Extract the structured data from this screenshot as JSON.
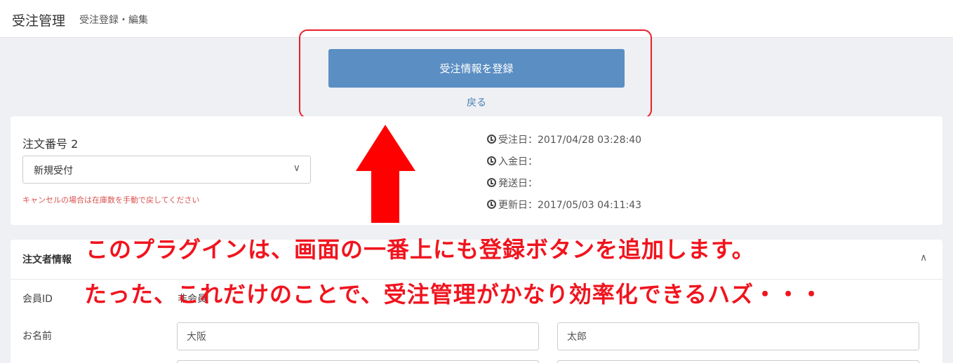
{
  "header": {
    "title": "受注管理",
    "subtitle": "受注登録・編集"
  },
  "actions": {
    "submit_label": "受注情報を登録",
    "back_label": "戻る"
  },
  "order": {
    "number_label": "注文番号 2",
    "status_selected": "新規受付",
    "cancel_note": "キャンセルの場合は在庫数を手動で戻してください",
    "dates": [
      {
        "text": "受注日：2017/04/28 03:28:40"
      },
      {
        "text": "入金日："
      },
      {
        "text": "発送日："
      },
      {
        "text": "更新日：2017/05/03 04:11:43"
      }
    ]
  },
  "customer": {
    "section_title": "注文者情報",
    "member_id_label": "会員ID",
    "member_id_value": "非会員",
    "name_label": "お名前",
    "last_name": "大阪",
    "first_name": "太郎"
  },
  "annotation": {
    "line1": "このプラグインは、画面の一番上にも登録ボタンを追加します。",
    "line2": "たった、これだけのことで、受注管理がかなり効率化できるハズ・・・",
    "color": "#f0141e"
  }
}
